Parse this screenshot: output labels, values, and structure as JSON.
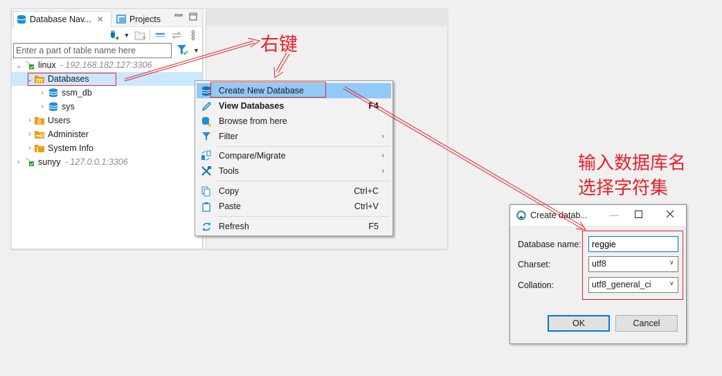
{
  "navigator": {
    "tabs": [
      {
        "label": "Database Nav...",
        "icon": "database-icon",
        "active": true
      },
      {
        "label": "Projects",
        "icon": "projects-icon",
        "active": false
      }
    ],
    "tab_close_glyph": "✕",
    "minimize_glyph": "▭",
    "maximize_glyph": "☐",
    "toolbar": [
      "new-connection-icon",
      "dropdown-arrow-icon",
      "new-folder-icon",
      "collapse-all-icon",
      "link-with-editor-icon",
      "more-options-icon"
    ],
    "filter": {
      "placeholder": "Enter a part of table name here",
      "value": ""
    },
    "tree": [
      {
        "label": "linux",
        "host": "- 192.168.182.127:3306",
        "level": 0,
        "expanded": true,
        "icon": "connection-icon"
      },
      {
        "label": "Databases",
        "level": 1,
        "expanded": true,
        "selected": true,
        "icon": "databases-folder-icon"
      },
      {
        "label": "ssm_db",
        "level": 2,
        "expanded": false,
        "icon": "database-icon"
      },
      {
        "label": "sys",
        "level": 2,
        "expanded": false,
        "icon": "database-icon"
      },
      {
        "label": "Users",
        "level": 1,
        "expanded": false,
        "icon": "users-folder-icon"
      },
      {
        "label": "Administer",
        "level": 1,
        "expanded": false,
        "icon": "administer-folder-icon"
      },
      {
        "label": "System Info",
        "level": 1,
        "expanded": false,
        "icon": "info-folder-icon"
      },
      {
        "label": "sunyy",
        "host": "- 127.0.0.1:3306",
        "level": 0,
        "expanded": false,
        "icon": "connection-icon"
      }
    ]
  },
  "context_menu": {
    "items": [
      {
        "label": "Create New Database",
        "shortcut": "",
        "submenu": false,
        "highlighted": true,
        "bold": false,
        "icon": "create-database-icon"
      },
      {
        "label": "View Databases",
        "shortcut": "F4",
        "submenu": false,
        "bold": true,
        "icon": "pencil-icon"
      },
      {
        "label": "Browse from here",
        "shortcut": "",
        "submenu": false,
        "icon": "browse-icon"
      },
      {
        "label": "Filter",
        "shortcut": "",
        "submenu": true,
        "icon": "filter-icon"
      },
      {
        "label": "Compare/Migrate",
        "shortcut": "",
        "submenu": true,
        "icon": "compare-icon"
      },
      {
        "label": "Tools",
        "shortcut": "",
        "submenu": true,
        "icon": "tools-icon"
      },
      {
        "label": "Copy",
        "shortcut": "Ctrl+C",
        "submenu": false,
        "icon": "copy-icon"
      },
      {
        "label": "Paste",
        "shortcut": "Ctrl+V",
        "submenu": false,
        "icon": "paste-icon"
      },
      {
        "label": "Refresh",
        "shortcut": "F5",
        "submenu": false,
        "icon": "refresh-icon"
      }
    ],
    "submenu_glyph": "›"
  },
  "dialog": {
    "title": "Create datab...",
    "minimize_glyph": "—",
    "maximize_glyph": "☐",
    "close_glyph": "✕",
    "fields": {
      "database_name": {
        "label": "Database name:",
        "value": "reggie"
      },
      "charset": {
        "label": "Charset:",
        "value": "utf8"
      },
      "collation": {
        "label": "Collation:",
        "value": "utf8_general_ci"
      }
    },
    "dropdown_glyph": "∨",
    "ok_label": "OK",
    "cancel_label": "Cancel"
  },
  "annotations": {
    "right_click": "右键",
    "instruction_line1": "输入数据库名",
    "instruction_line2": "选择字符集",
    "color": "#e8202a"
  },
  "colors": {
    "selection": "#cce8ff",
    "menu_highlight": "#91c9f7",
    "accent_blue": "#0078d7",
    "db_icon_blue": "#1a8fd6",
    "folder_orange": "#f39c12"
  }
}
